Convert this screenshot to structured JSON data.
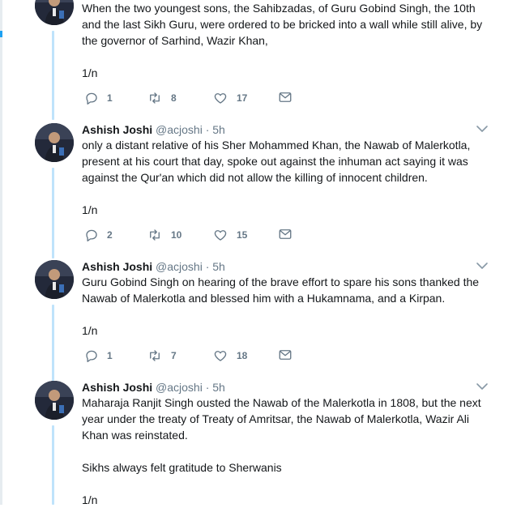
{
  "tweets": [
    {
      "name": "",
      "handle": "",
      "time": "",
      "text": "When the two youngest sons, the Sahibzadas, of Guru Gobind Singh, the 10th and the last Sikh Guru, were ordered to be bricked into a wall while still alive, by the governor of Sarhind, Wazir Khan,\n\n1/n",
      "replies": "1",
      "retweets": "8",
      "likes": "17"
    },
    {
      "name": "Ashish Joshi",
      "handle": "@acjoshi",
      "time": "· 5h",
      "text": "only a distant relative of his Sher Mohammed Khan, the Nawab of Malerkotla, present at his court that day, spoke out against the inhuman act saying it was against the Qur'an which did not allow the killing of innocent children.\n\n1/n",
      "replies": "2",
      "retweets": "10",
      "likes": "15"
    },
    {
      "name": "Ashish Joshi",
      "handle": "@acjoshi",
      "time": "· 5h",
      "text": "Guru Gobind Singh on hearing of the brave effort to spare his sons thanked the Nawab of Malerkotla and blessed him with a Hukamnama, and a Kirpan.\n\n1/n",
      "replies": "1",
      "retweets": "7",
      "likes": "18"
    },
    {
      "name": "Ashish Joshi",
      "handle": "@acjoshi",
      "time": "· 5h",
      "text": "Maharaja Ranjit Singh ousted the Nawab of the Malerkotla in 1808, but the next year under the treaty of Treaty of Amritsar, the Nawab of Malerkotla, Wazir Ali Khan was reinstated.\n\nSikhs always felt gratitude to Sherwanis\n\n1/n"
    }
  ],
  "icons": {
    "reply": "reply-icon",
    "retweet": "retweet-icon",
    "like": "heart-icon",
    "dm": "envelope-icon",
    "more": "chevron-down-icon"
  },
  "colors": {
    "thread_line": "#bfe3fb",
    "icon_gray": "#657786",
    "text": "#14171a",
    "accent": "#1da1f2"
  }
}
